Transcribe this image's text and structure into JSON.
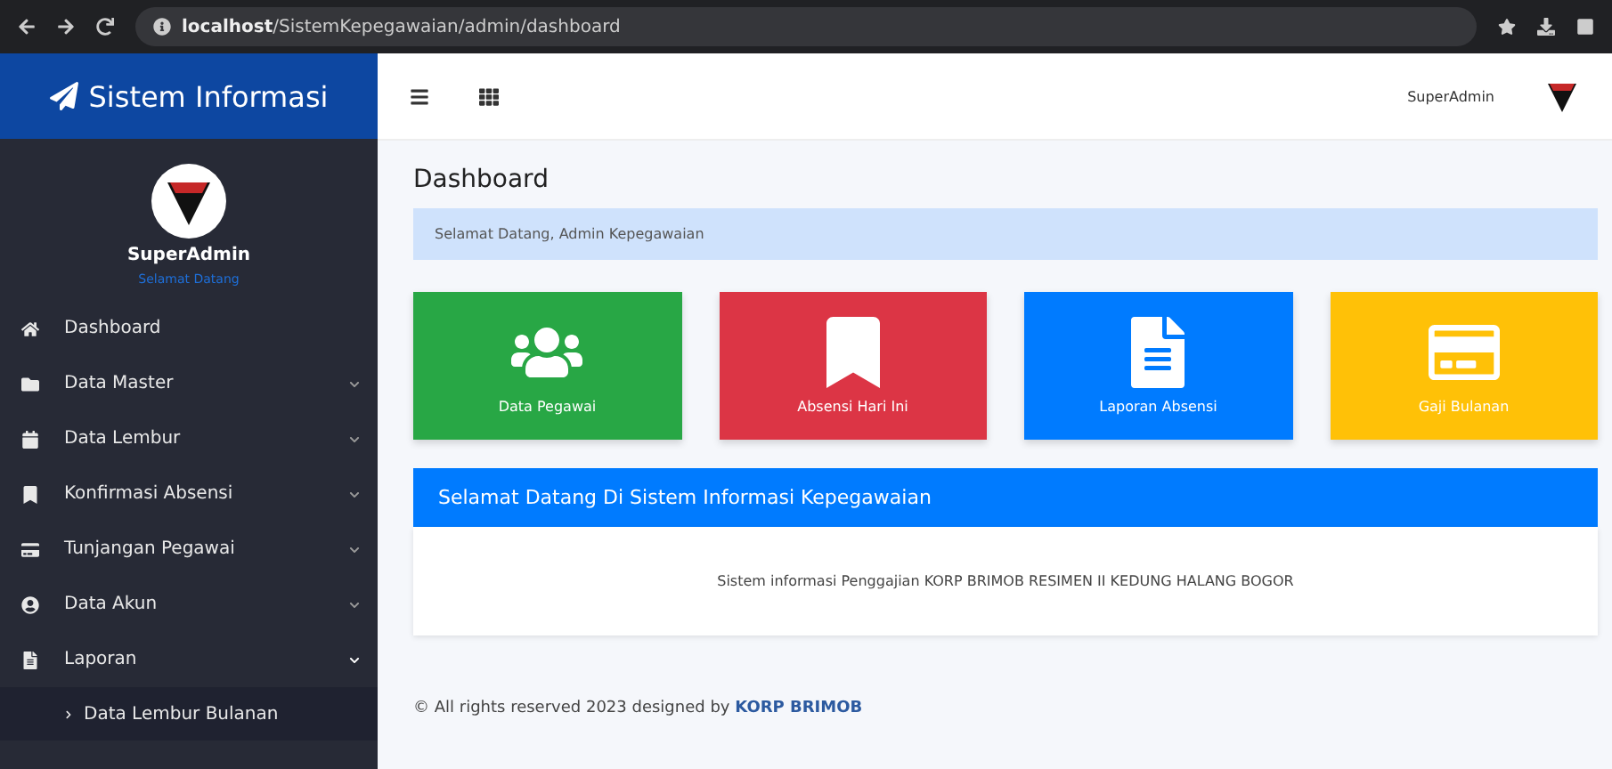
{
  "browser": {
    "url_host": "localhost",
    "url_path": "/SistemKepegawaian/admin/dashboard"
  },
  "sidebar": {
    "brand": "Sistem Informasi",
    "user": {
      "name": "SuperAdmin",
      "status": "Selamat Datang"
    },
    "items": [
      {
        "label": "Dashboard",
        "expandable": false
      },
      {
        "label": "Data Master",
        "expandable": true,
        "expanded": false
      },
      {
        "label": "Data Lembur",
        "expandable": true,
        "expanded": false
      },
      {
        "label": "Konfirmasi Absensi",
        "expandable": true,
        "expanded": false
      },
      {
        "label": "Tunjangan Pegawai",
        "expandable": true,
        "expanded": false
      },
      {
        "label": "Data Akun",
        "expandable": true,
        "expanded": false
      },
      {
        "label": "Laporan",
        "expandable": true,
        "expanded": true,
        "children": [
          {
            "label": "Data Lembur Bulanan"
          }
        ]
      }
    ]
  },
  "topbar": {
    "user": "SuperAdmin"
  },
  "page": {
    "title": "Dashboard",
    "alert": "Selamat Datang, Admin Kepegawaian",
    "cards": [
      {
        "label": "Data Pegawai",
        "kind": "users",
        "color": "#28a745"
      },
      {
        "label": "Absensi Hari Ini",
        "kind": "bookmark",
        "color": "#dc3545"
      },
      {
        "label": "Laporan Absensi",
        "kind": "document",
        "color": "#007bff"
      },
      {
        "label": "Gaji Bulanan",
        "kind": "card",
        "color": "#ffc107"
      }
    ],
    "panel": {
      "heading": "Selamat Datang Di Sistem Informasi Kepegawaian",
      "body": "Sistem informasi Penggajian KORP BRIMOB RESIMEN II KEDUNG HALANG BOGOR"
    },
    "footer": {
      "text": "© All rights reserved 2023 designed by",
      "link": "KORP BRIMOB"
    }
  }
}
